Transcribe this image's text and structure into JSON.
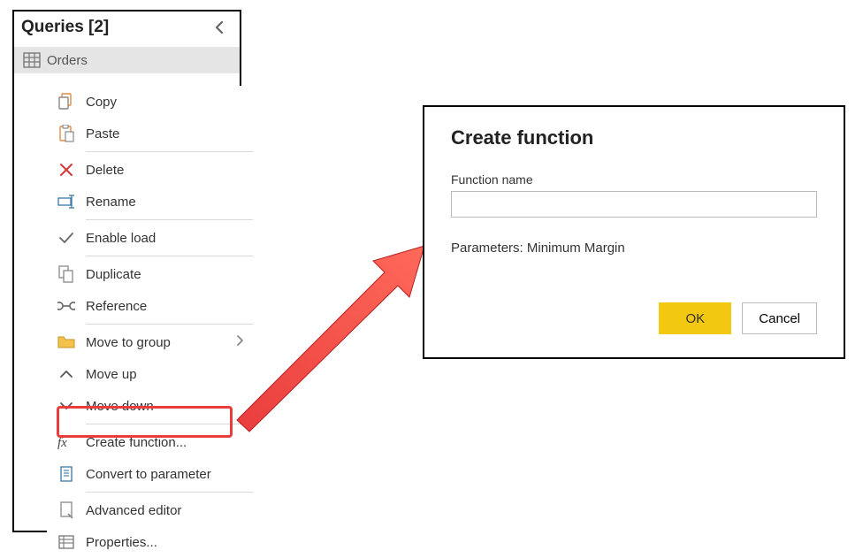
{
  "panel": {
    "title": "Queries [2]",
    "query_name": "Orders"
  },
  "menu": {
    "copy": "Copy",
    "paste": "Paste",
    "delete": "Delete",
    "rename": "Rename",
    "enable_load": "Enable load",
    "duplicate": "Duplicate",
    "reference": "Reference",
    "move_to_group": "Move to group",
    "move_up": "Move up",
    "move_down": "Move down",
    "create_function": "Create function...",
    "convert_to_parameter": "Convert to parameter",
    "advanced_editor": "Advanced editor",
    "properties": "Properties..."
  },
  "dialog": {
    "title": "Create function",
    "field_label": "Function name",
    "input_value": "",
    "params_label": "Parameters: Minimum Margin",
    "ok": "OK",
    "cancel": "Cancel"
  },
  "colors": {
    "highlight": "#e93d3d",
    "accent": "#f2c811"
  }
}
